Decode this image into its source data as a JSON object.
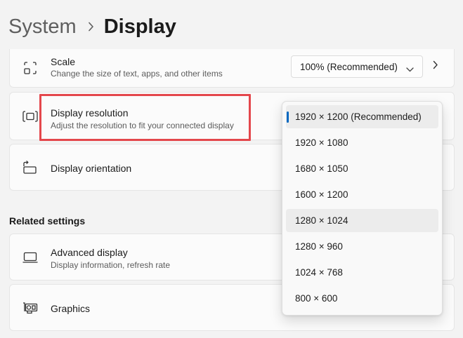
{
  "header": {
    "parent": "System",
    "current": "Display"
  },
  "scale": {
    "title": "Scale",
    "description": "Change the size of text, apps, and other items",
    "value": "100% (Recommended)"
  },
  "resolution": {
    "title": "Display resolution",
    "description": "Adjust the resolution to fit your connected display",
    "options": [
      "1920 × 1200 (Recommended)",
      "1920 × 1080",
      "1680 × 1050",
      "1600 × 1200",
      "1280 × 1024",
      "1280 × 960",
      "1024 × 768",
      "800 × 600"
    ]
  },
  "orientation": {
    "title": "Display orientation"
  },
  "related": {
    "label": "Related settings",
    "advanced": {
      "title": "Advanced display",
      "description": "Display information, refresh rate"
    },
    "graphics": {
      "title": "Graphics"
    }
  },
  "colors": {
    "accent": "#0067c0",
    "highlight": "#e4474c"
  }
}
